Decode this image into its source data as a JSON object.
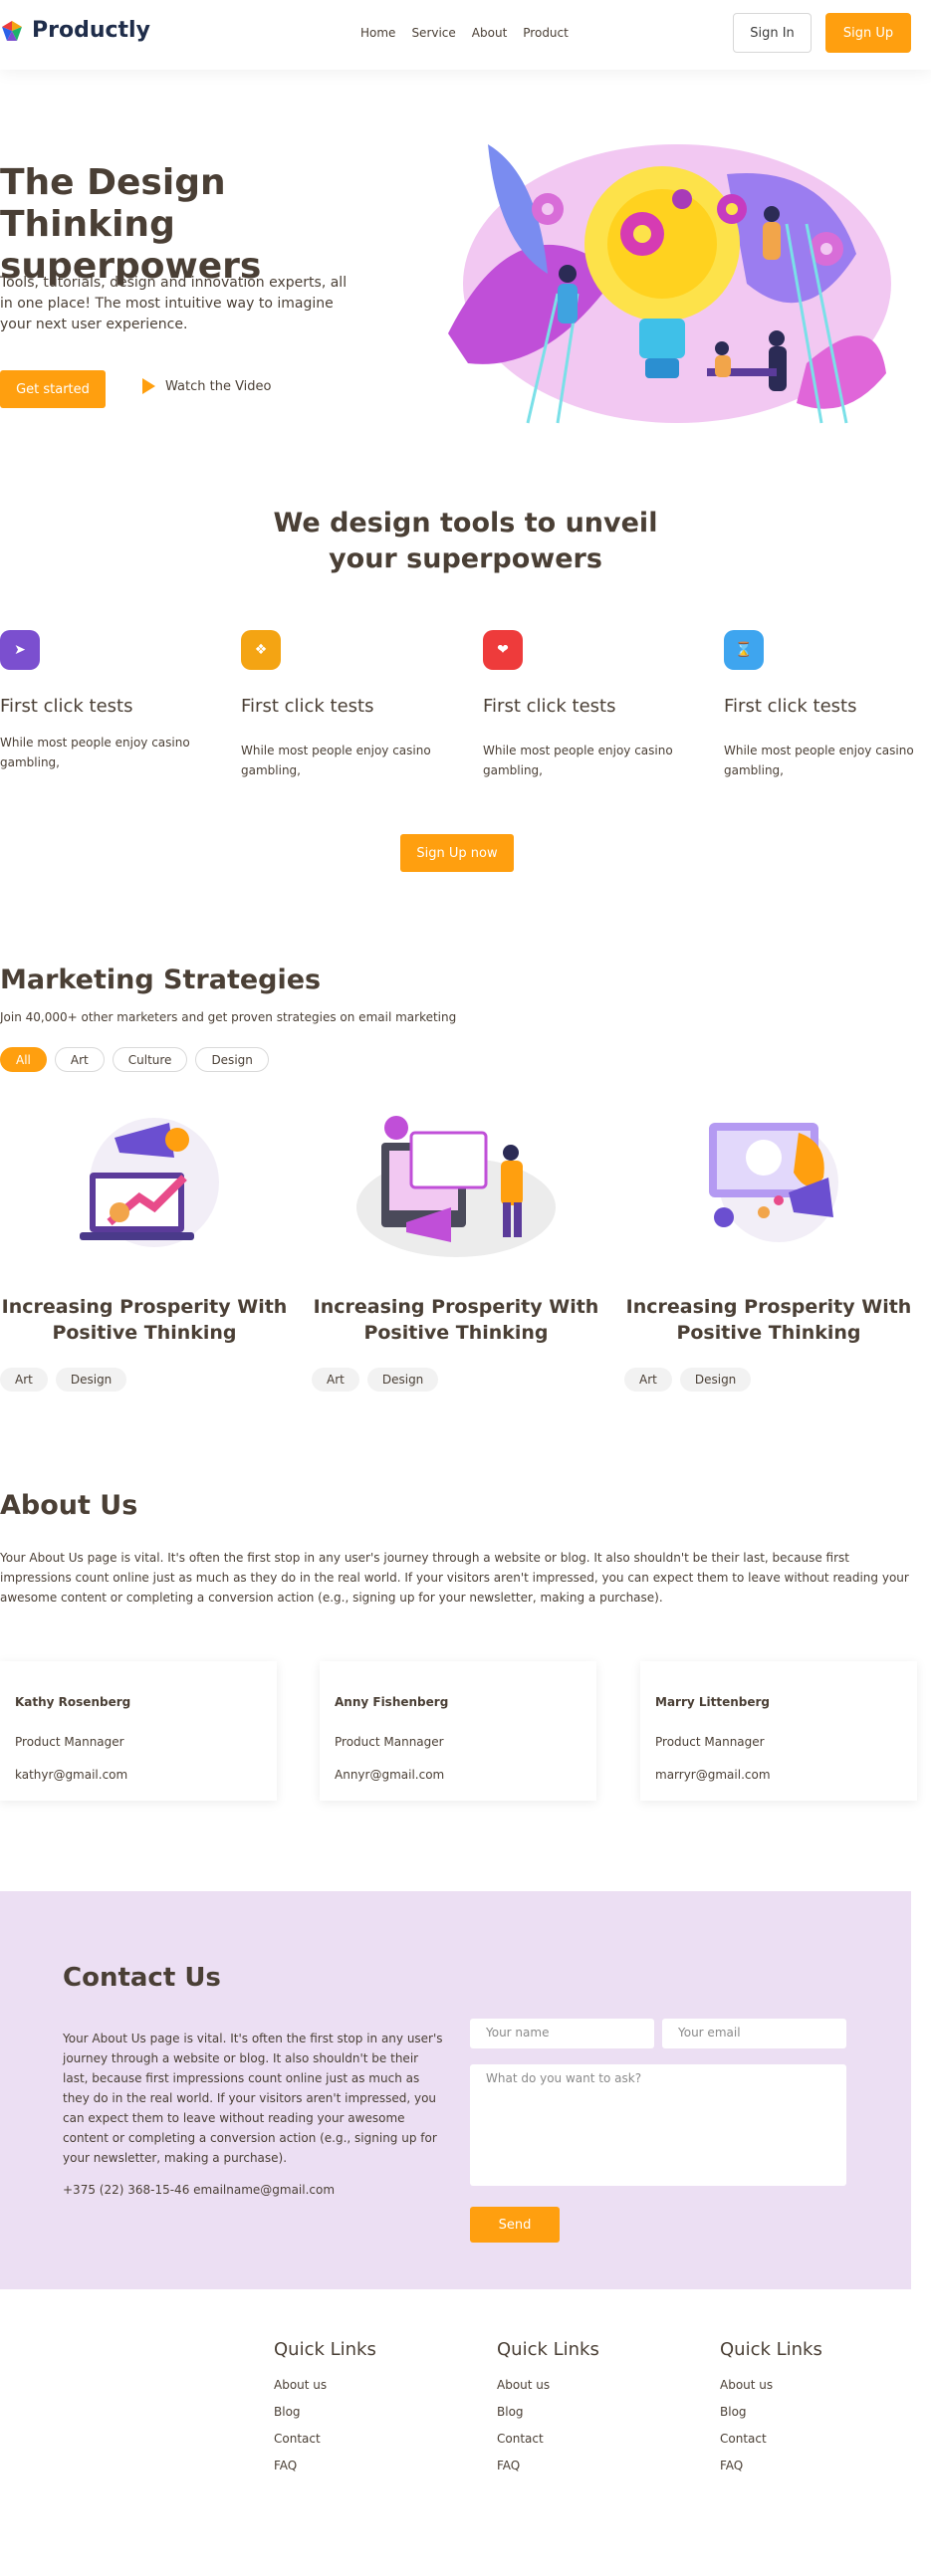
{
  "header": {
    "brand": "Productly",
    "nav": [
      "Home",
      "Service",
      "About",
      "Product"
    ],
    "signin_label": "Sign In",
    "signup_label": "Sign Up"
  },
  "hero": {
    "title": "The Design Thinking superpowers",
    "text": "Tools, tutorials, design and innovation experts, all in one place! The most intuitive way to imagine your next user experience.",
    "cta_label": "Get started",
    "video_label": "Watch the Video"
  },
  "tools": {
    "title_line1": "We design tools to unveil",
    "title_line2": "your superpowers",
    "features": [
      {
        "title": "First click tests",
        "text": "While most people enjoy casino gambling,",
        "color": "#7b4fcf",
        "icon": "cursor-icon"
      },
      {
        "title": "First click tests",
        "text": "While most people enjoy casino gambling,",
        "color": "#f4a413",
        "icon": "diamonds-icon"
      },
      {
        "title": "First click tests",
        "text": "While most people enjoy casino gambling,",
        "color": "#ee3b3b",
        "icon": "heart-icon"
      },
      {
        "title": "First click tests",
        "text": "While most people enjoy casino gambling,",
        "color": "#3ea5ef",
        "icon": "hourglass-icon"
      }
    ],
    "cta_label": "Sign Up now"
  },
  "marketing": {
    "title": "Marketing Strategies",
    "subtitle": "Join 40,000+ other marketers and get proven strategies on email marketing",
    "filters": [
      "All",
      "Art",
      "Culture",
      "Design"
    ],
    "cards": [
      {
        "title": "Increasing Prosperity With Positive Thinking",
        "tags": [
          "Art",
          "Design"
        ]
      },
      {
        "title": "Increasing Prosperity With Positive Thinking",
        "tags": [
          "Art",
          "Design"
        ]
      },
      {
        "title": "Increasing Prosperity With Positive Thinking",
        "tags": [
          "Art",
          "Design"
        ]
      }
    ]
  },
  "about": {
    "title": "About Us",
    "text": "Your About Us page is vital. It's often the first stop in any user's journey through a website or blog. It also shouldn't be their last, because first impressions count online just as much as they do in the real world. If your visitors aren't impressed, you can expect them to leave without reading your awesome content or completing a conversion action (e.g., signing up for your newsletter, making a purchase).",
    "people": [
      {
        "name": "Kathy Rosenberg",
        "role": "Product Mannager",
        "email": "kathyr@gmail.com"
      },
      {
        "name": "Anny Fishenberg",
        "role": "Product Mannager",
        "email": "Annyr@gmail.com"
      },
      {
        "name": "Marry Littenberg",
        "role": "Product Mannager",
        "email": "marryr@gmail.com"
      }
    ]
  },
  "contact": {
    "title": "Contact Us",
    "text": "Your About Us page is vital. It's often the first stop in any user's journey through a website or blog. It also shouldn't be their last, because first impressions count online just as much as they do in the real world. If your visitors aren't impressed, you can expect them to leave without reading your awesome content or completing a conversion action (e.g., signing up for your newsletter, making a purchase).",
    "phone_email": "+375 (22) 368-15-46 emailname@gmail.com",
    "name_placeholder": "Your name",
    "email_placeholder": "Your email",
    "message_placeholder": "What do you want to ask?",
    "send_label": "Send"
  },
  "footer": {
    "columns": [
      {
        "title": "Quick Links",
        "links": [
          "About us",
          "Blog",
          "Contact",
          "FAQ"
        ]
      },
      {
        "title": "Quick Links",
        "links": [
          "About us",
          "Blog",
          "Contact",
          "FAQ"
        ]
      },
      {
        "title": "Quick Links",
        "links": [
          "About us",
          "Blog",
          "Contact",
          "FAQ"
        ]
      }
    ]
  },
  "colors": {
    "accent": "#ff9f0f",
    "text": "#4a3f35",
    "contact_bg": "#ecdff3"
  }
}
